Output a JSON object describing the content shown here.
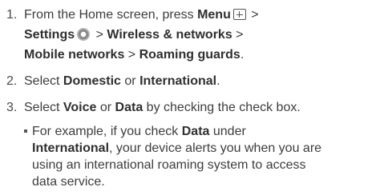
{
  "steps": [
    {
      "number": "1.",
      "line1_text": "From the Home screen, press ",
      "line1_bold": "Menu",
      "line1_end": " >",
      "line2_bold1": "Settings",
      "line2_mid": " > ",
      "line2_bold2": "Wireless & networks",
      "line2_end": " >",
      "line3_bold1": "Mobile networks",
      "line3_mid": " > ",
      "line3_bold2": "Roaming guards",
      "line3_end": "."
    },
    {
      "number": "2.",
      "text_start": "Select ",
      "bold1": "Domestic",
      "mid": " or ",
      "bold2": "International",
      "end": "."
    },
    {
      "number": "3.",
      "text_start": "Select ",
      "bold1": "Voice",
      "mid": " or ",
      "bold2": "Data",
      "end": " by checking the check box."
    }
  ],
  "note": {
    "l1_start": "For example, if you check ",
    "l1_bold": "Data",
    "l1_end": " under",
    "l2_bold": "International",
    "l2_end": ", your device alerts you when you are",
    "l3": "using an international roaming system to access",
    "l4": "data service."
  },
  "icons": [
    "menu-icon",
    "settings-gear-icon"
  ]
}
